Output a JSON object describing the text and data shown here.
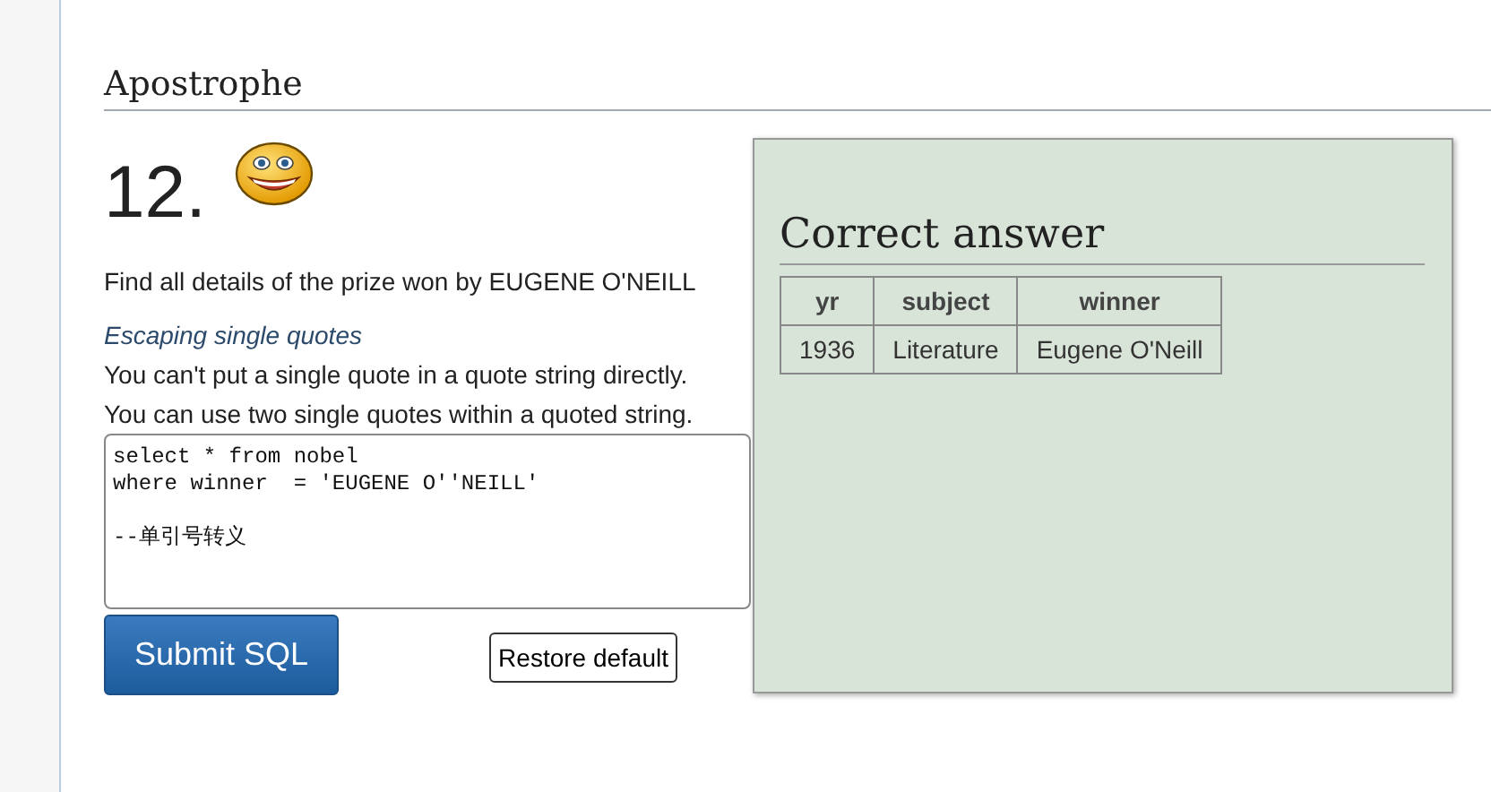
{
  "section_title": "Apostrophe",
  "question": {
    "number": "12.",
    "text": "Find all details of the prize won by EUGENE O'NEILL"
  },
  "hint": {
    "title": "Escaping single quotes",
    "lines": [
      "You can't put a single quote in a quote string directly.",
      "You can use two single quotes within a quoted string."
    ]
  },
  "editor": {
    "value": "select * from nobel\nwhere winner  = 'EUGENE O''NEILL'\n\n--单引号转义"
  },
  "buttons": [
    {
      "label": "Submit SQL",
      "kind": "primary"
    },
    {
      "label": "Restore default",
      "kind": "plain"
    }
  ],
  "answer": {
    "title": "Correct answer",
    "columns": [
      "yr",
      "subject",
      "winner"
    ],
    "rows": [
      [
        "1936",
        "Literature",
        "Eugene O'Neill"
      ]
    ]
  }
}
